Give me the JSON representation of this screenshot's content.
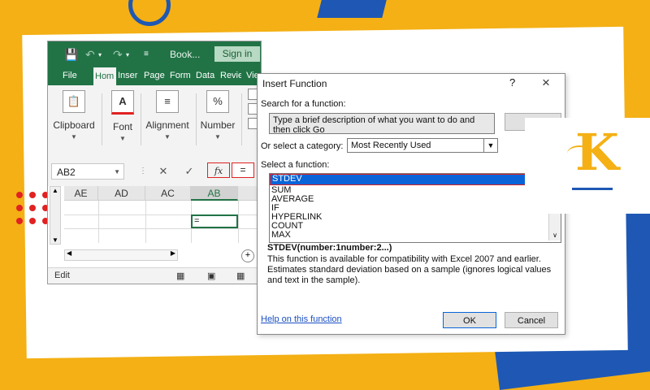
{
  "excel": {
    "title": "Book...",
    "signin": "Sign in",
    "tabs": [
      "File",
      "Hom",
      "Inser",
      "Page",
      "Form",
      "Data",
      "Revie",
      "Vie"
    ],
    "ribbon": [
      {
        "label": "Clipboard",
        "icon": "clipboard-icon"
      },
      {
        "label": "Font",
        "icon": "font-color-icon"
      },
      {
        "label": "Alignment",
        "icon": "alignment-icon"
      },
      {
        "label": "Number",
        "icon": "percent-icon"
      }
    ],
    "namebox": "AB2",
    "fx_label": "fx",
    "formula": "=",
    "columns": [
      "AE",
      "AD",
      "AC",
      "AB"
    ],
    "selected_column": "AB",
    "active_cell_value": "=",
    "status": "Edit"
  },
  "dialog": {
    "title": "Insert Function",
    "help_glyph": "?",
    "search_label": "Search for a function:",
    "search_value": "Type a brief description of what you want to do and then click Go",
    "category_label": "Or select a category:",
    "category_value": "Most Recently Used",
    "select_label": "Select a function:",
    "functions": [
      "STDEV",
      "SUM",
      "AVERAGE",
      "IF",
      "HYPERLINK",
      "COUNT",
      "MAX"
    ],
    "selected_function": "STDEV",
    "syntax": "STDEV(number:1number:2...)",
    "description": "This function is available for compatibility with Excel 2007 and earlier. Estimates standard deviation based on a sample (ignores logical values and text in the sample).",
    "help_link": "Help on this function",
    "ok": "OK",
    "cancel": "Cancel"
  },
  "colors": {
    "excel_green": "#217346",
    "background_yellow": "#f4b014",
    "accent_blue": "#1e58b4",
    "highlight_red": "#e02222",
    "selection_blue": "#0a64d8"
  }
}
